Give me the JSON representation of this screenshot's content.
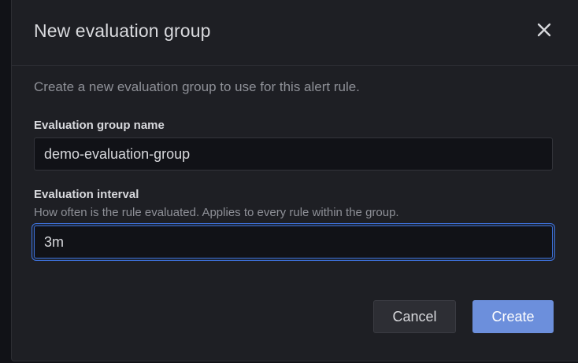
{
  "modal": {
    "title": "New evaluation group",
    "description": "Create a new evaluation group to use for this alert rule.",
    "close_icon": "close-icon"
  },
  "fields": {
    "group_name": {
      "label": "Evaluation group name",
      "value": "demo-evaluation-group"
    },
    "interval": {
      "label": "Evaluation interval",
      "help": "How often is the rule evaluated. Applies to every rule within the group.",
      "value": "3m"
    }
  },
  "actions": {
    "cancel_label": "Cancel",
    "create_label": "Create"
  },
  "colors": {
    "accent": "#3d71d9",
    "primary_button": "#6c8fdc",
    "background": "#1e1f24"
  }
}
